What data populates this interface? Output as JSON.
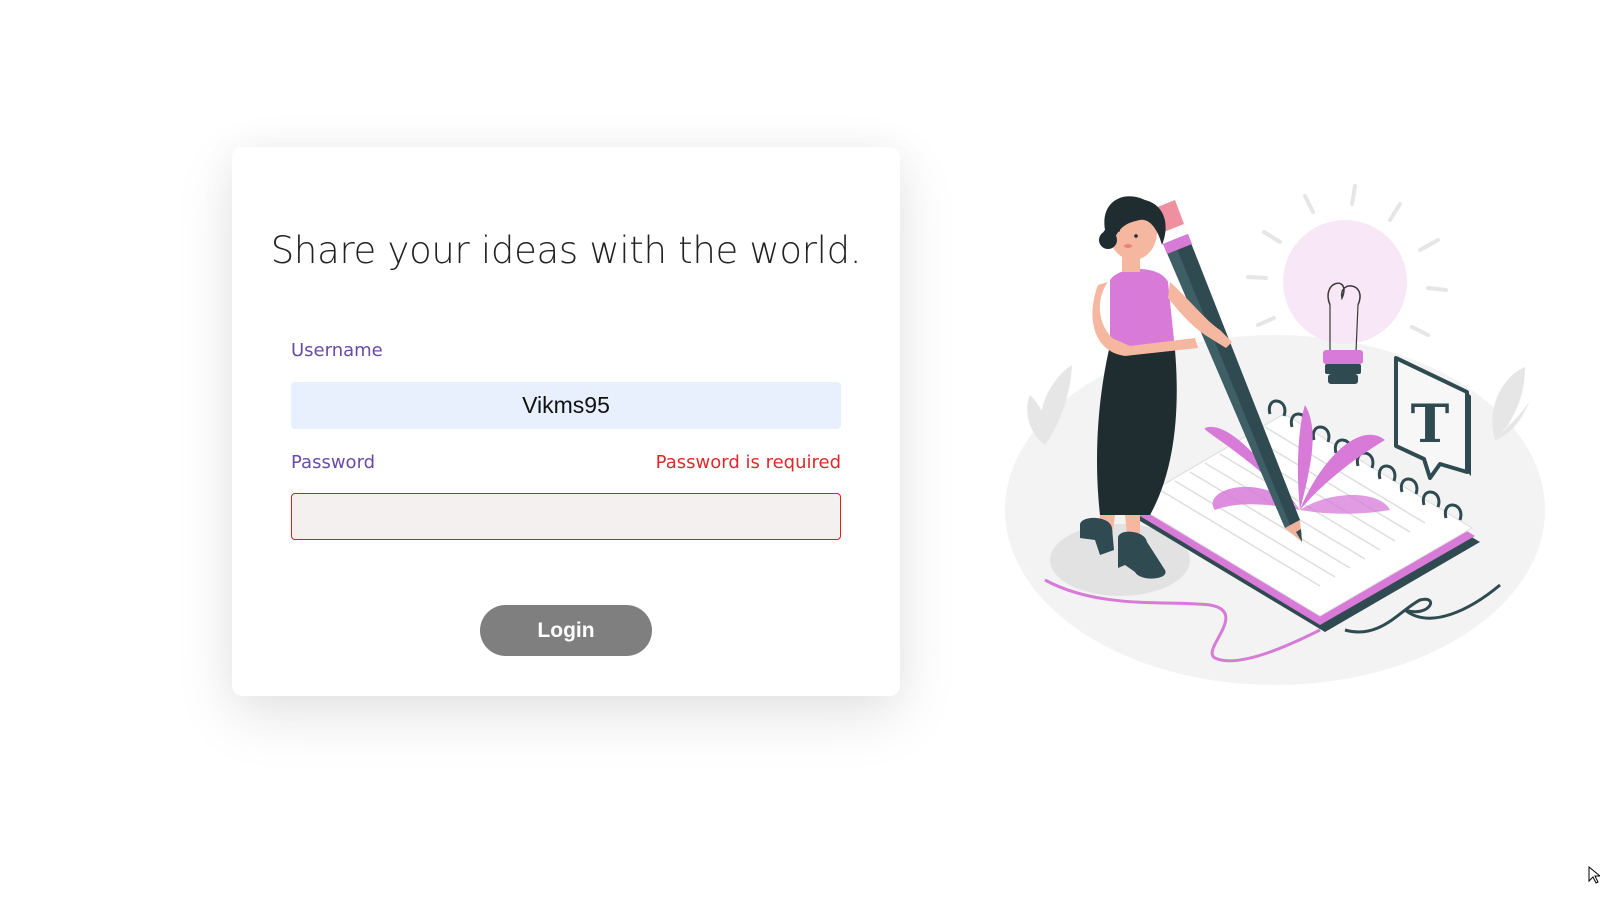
{
  "login_card": {
    "headline": "Share your ideas with the world.",
    "username": {
      "label": "Username",
      "value": "Vikms95"
    },
    "password": {
      "label": "Password",
      "value": "",
      "error": "Password is required"
    },
    "login_button_label": "Login"
  },
  "illustration": {
    "icon": "woman-writing-with-giant-pencil-illustration",
    "sign_letter": "T"
  },
  "colors": {
    "label": "#6b4aa6",
    "error": "#e0282b",
    "username_field_bg": "#e8f0fe",
    "password_field_bg": "#f4f0f0",
    "button_bg": "#7f7f7f",
    "accent_pink": "#d977d9",
    "dark_teal": "#2f4a50"
  }
}
